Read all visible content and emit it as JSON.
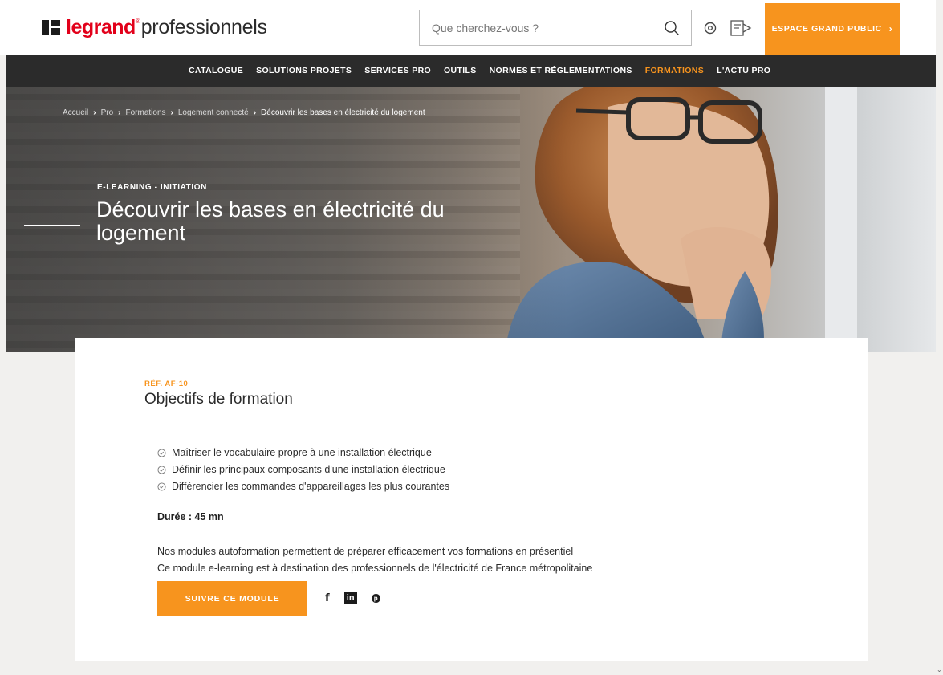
{
  "header": {
    "logo_bold": "legrand",
    "logo_reg": "®",
    "logo_light": "professionnels",
    "search_placeholder": "Que cherchez-vous ?",
    "espace_label": "ESPACE GRAND PUBLIC",
    "espace_chevron": "›"
  },
  "nav": {
    "items": [
      "CATALOGUE",
      "SOLUTIONS PROJETS",
      "SERVICES PRO",
      "OUTILS",
      "NORMES ET RÉGLEMENTATIONS",
      "FORMATIONS",
      "L'ACTU PRO"
    ],
    "active": "FORMATIONS"
  },
  "breadcrumb": {
    "items": [
      "Accueil",
      "Pro",
      "Formations",
      "Logement connecté"
    ],
    "current": "Découvrir les bases en électricité du logement",
    "separator": "›"
  },
  "hero": {
    "kicker": "E-LEARNING - INITIATION",
    "title": "Découvrir les bases en électricité du logement"
  },
  "card": {
    "ref": "RÉF. AF-10",
    "title": "Objectifs de formation",
    "objectives": [
      "Maîtriser le vocabulaire propre à une installation électrique",
      "Définir les principaux composants d'une installation électrique",
      "Différencier les commandes d'appareillages les plus courantes"
    ],
    "duree": "Durée : 45 mn",
    "desc_line1": "Nos modules autoformation permettent de préparer efficacement vos formations en présentiel",
    "desc_line2": "Ce module e-learning est à destination des professionnels de l'électricité de France métropolitaine",
    "cta": "SUIVRE CE MODULE",
    "socials": {
      "facebook": "f",
      "linkedin": "in",
      "pinterest": "p"
    }
  },
  "colors": {
    "accent": "#f7941e",
    "brand_red": "#e2001a",
    "nav_bg": "#2b2b2b",
    "page_bg": "#f1f0ee"
  },
  "icons": [
    "search-icon",
    "location-icon",
    "catalog-icon",
    "check-circle-icon",
    "facebook-icon",
    "linkedin-icon",
    "pinterest-icon"
  ]
}
